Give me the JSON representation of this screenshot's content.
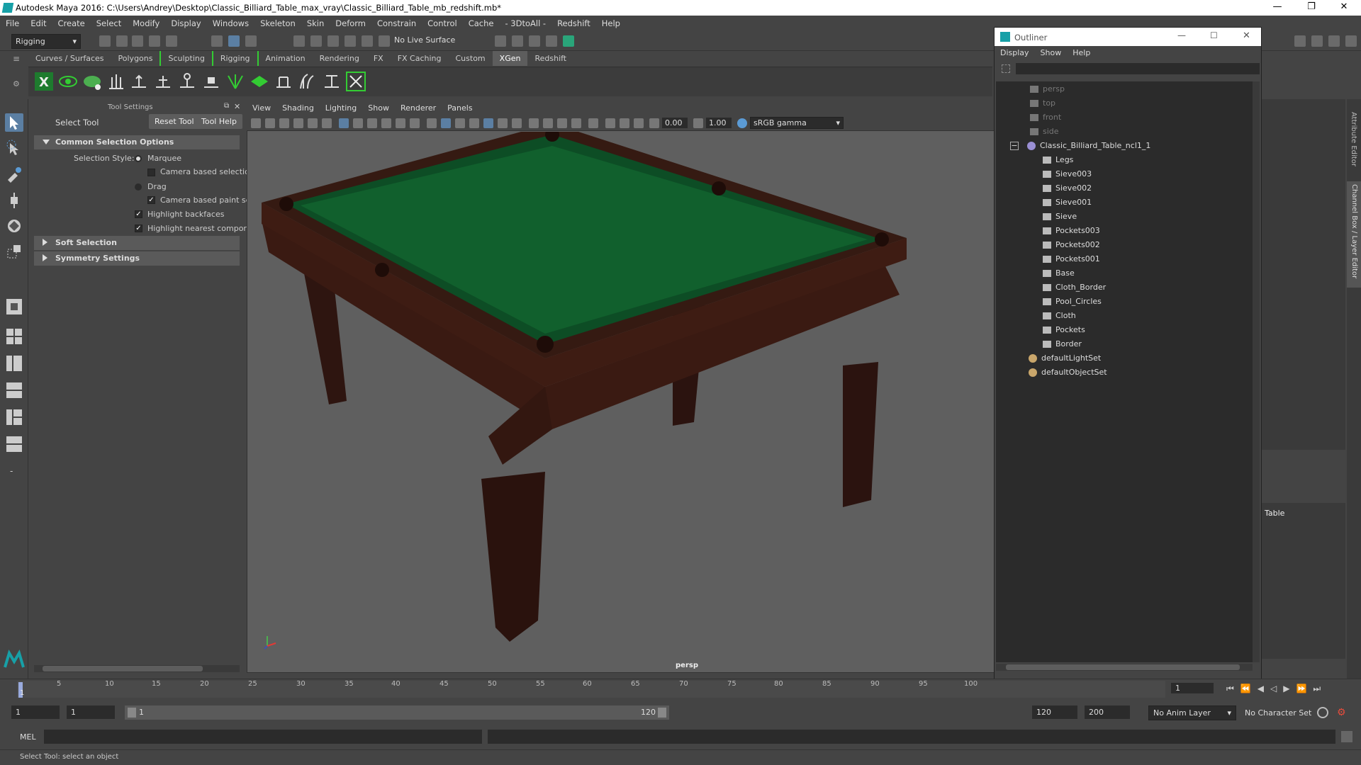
{
  "window": {
    "title": "Autodesk Maya 2016: C:\\Users\\Andrey\\Desktop\\Classic_Billiard_Table_max_vray\\Classic_Billiard_Table_mb_redshift.mb*"
  },
  "menubar": [
    "File",
    "Edit",
    "Create",
    "Select",
    "Modify",
    "Display",
    "Windows",
    "Skeleton",
    "Skin",
    "Deform",
    "Constrain",
    "Control",
    "Cache",
    "- 3DtoAll -",
    "Redshift",
    "Help"
  ],
  "statusline": {
    "mode": "Rigging",
    "live_surface": "No Live Surface"
  },
  "shelf_tabs": [
    "Curves / Surfaces",
    "Polygons",
    "Sculpting",
    "Rigging",
    "Animation",
    "Rendering",
    "FX",
    "FX Caching",
    "Custom",
    "XGen",
    "Redshift"
  ],
  "shelf_active": "XGen",
  "tool_settings": {
    "header": "Tool Settings",
    "tool_name": "Select Tool",
    "reset_button": "Reset Tool",
    "help_button": "Tool Help",
    "sections": {
      "common": "Common Selection Options",
      "soft": "Soft Selection",
      "symmetry": "Symmetry Settings"
    },
    "selection_style_label": "Selection Style:",
    "marquee": "Marquee",
    "camera_based_selection": "Camera based selectio",
    "drag": "Drag",
    "camera_based_paint": "Camera based paint se",
    "highlight_backfaces": "Highlight backfaces",
    "highlight_nearest": "Highlight nearest compor"
  },
  "viewport": {
    "menus": [
      "View",
      "Shading",
      "Lighting",
      "Show",
      "Renderer",
      "Panels"
    ],
    "exposure": "0.00",
    "gamma": "1.00",
    "color_space": "sRGB gamma",
    "camera_label": "persp"
  },
  "outliner": {
    "title": "Outliner",
    "menus": [
      "Display",
      "Show",
      "Help"
    ],
    "cameras": [
      "persp",
      "top",
      "front",
      "side"
    ],
    "group": "Classic_Billiard_Table_ncl1_1",
    "children": [
      "Legs",
      "Sieve003",
      "Sieve002",
      "Sieve001",
      "Sieve",
      "Pockets003",
      "Pockets002",
      "Pockets001",
      "Base",
      "Cloth_Border",
      "Pool_Circles",
      "Cloth",
      "Pockets",
      "Border"
    ],
    "sets": [
      "defaultLightSet",
      "defaultObjectSet"
    ]
  },
  "right_panel": {
    "layer_name": "Table",
    "tab_attr": "Attribute Editor",
    "tab_channel": "Channel Box / Layer Editor"
  },
  "timeline": {
    "ticks": [
      "1",
      "5",
      "10",
      "15",
      "20",
      "25",
      "30",
      "35",
      "40",
      "45",
      "50",
      "55",
      "60",
      "65",
      "70",
      "75",
      "80",
      "85",
      "90",
      "95",
      "100"
    ],
    "current_frame": "1"
  },
  "range": {
    "start": "1",
    "playback_start": "1",
    "slider_start": "1",
    "slider_end": "120",
    "playback_end": "120",
    "end": "200",
    "anim_layer": "No Anim Layer",
    "character_set": "No Character Set"
  },
  "command_line": {
    "label": "MEL"
  },
  "help_line": "Select Tool: select an object"
}
